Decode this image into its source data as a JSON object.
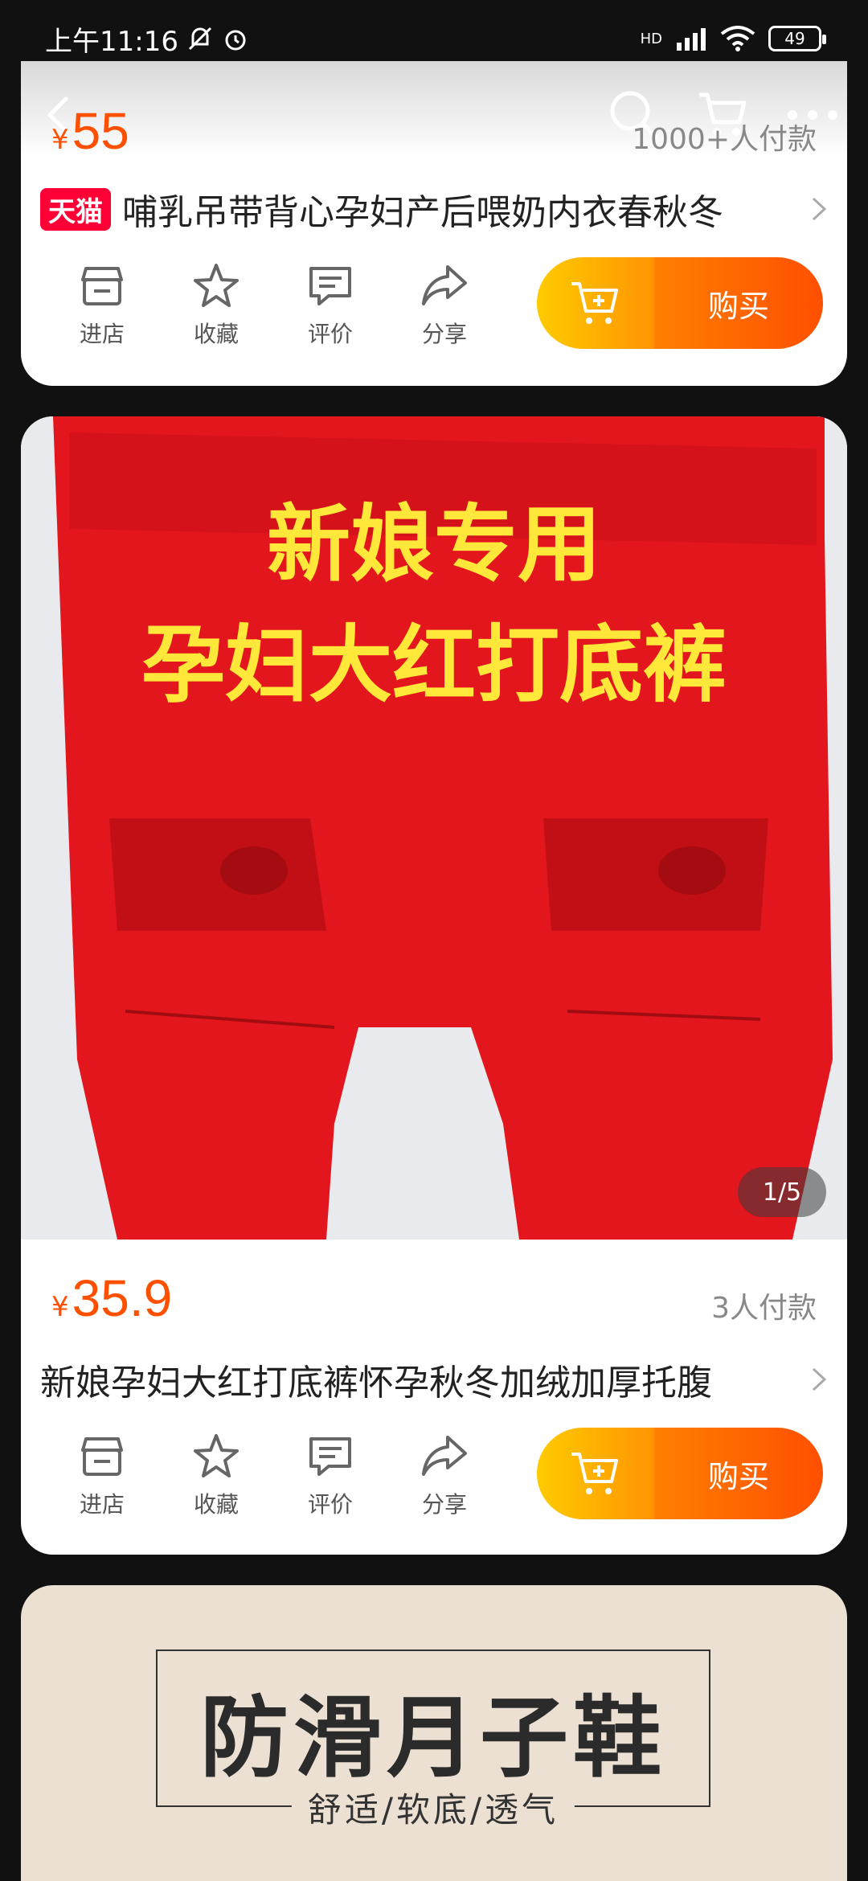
{
  "status_bar": {
    "time": "上午11:16",
    "network": "HD",
    "battery": "49"
  },
  "product1": {
    "price_symbol": "¥",
    "price": "55",
    "paid_count": "1000+人付款",
    "badge": "天猫",
    "title": "哺乳吊带背心孕妇产后喂奶内衣春秋冬"
  },
  "product2": {
    "price_symbol": "¥",
    "price": "35.9",
    "paid_count": "3人付款",
    "title": "新娘孕妇大红打底裤怀孕秋冬加绒加厚托腹",
    "image_text_line1": "新娘专用",
    "image_text_line2": "孕妇大红打底裤",
    "image_counter": "1/5"
  },
  "actions": {
    "store": "进店",
    "favorite": "收藏",
    "review": "评价",
    "share": "分享",
    "buy": "购买"
  },
  "product3": {
    "banner_title": "防滑月子鞋",
    "banner_subtitle": "舒适/软底/透气"
  },
  "colors": {
    "price": "#ff5000",
    "tmall": "#ff0036",
    "cart_gradient_start": "#ffcb00",
    "buy_gradient_end": "#ff4f00"
  },
  "icons": [
    "back-icon",
    "search-icon",
    "cart-icon",
    "more-icon",
    "store-icon",
    "star-icon",
    "comment-icon",
    "share-icon",
    "chevron-right-icon",
    "add-to-cart-icon"
  ]
}
